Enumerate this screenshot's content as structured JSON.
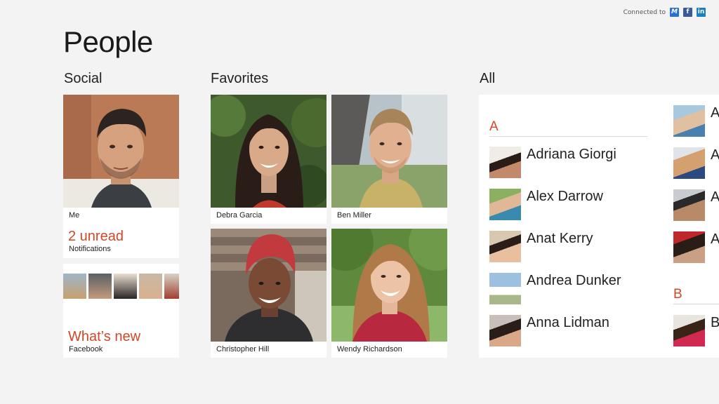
{
  "header": {
    "connected_label": "Connected to",
    "services": [
      {
        "name": "msn-icon",
        "glyph": "M"
      },
      {
        "name": "facebook-icon",
        "glyph": "f"
      },
      {
        "name": "linkedin-icon",
        "glyph": "in"
      }
    ]
  },
  "page": {
    "title": "People"
  },
  "social": {
    "title": "Social",
    "me_label": "Me",
    "notifications_count": "2 unread",
    "notifications_label": "Notifications",
    "whats_new_label": "What’s new",
    "whats_new_source": "Facebook"
  },
  "favorites": {
    "title": "Favorites",
    "people": [
      {
        "name": "Debra Garcia"
      },
      {
        "name": "Ben Miller"
      },
      {
        "name": "Christopher Hill"
      },
      {
        "name": "Wendy Richardson"
      }
    ]
  },
  "all": {
    "title": "All",
    "group_a": "A",
    "group_b": "B",
    "contacts_a": [
      {
        "name": "Adriana Giorgi"
      },
      {
        "name": "Alex Darrow"
      },
      {
        "name": "Anat Kerry"
      },
      {
        "name": "Andrea Dunker"
      },
      {
        "name": "Anna Lidman"
      }
    ],
    "contacts_col2": [
      {
        "name": "A"
      },
      {
        "name": "A"
      },
      {
        "name": "A"
      },
      {
        "name": "A"
      },
      {
        "name": "B"
      }
    ]
  },
  "colors": {
    "accent": "#d24726",
    "background": "#f3f3f3",
    "tile": "#ffffff"
  }
}
